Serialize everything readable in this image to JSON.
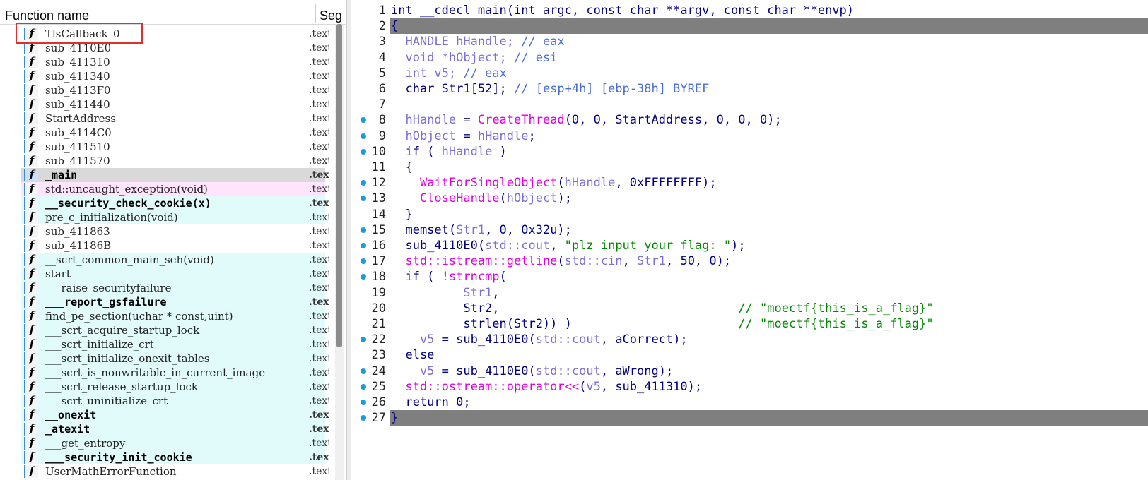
{
  "functions_pane": {
    "header": {
      "name_label": "Function name",
      "segment_label": "Seg"
    },
    "rows": [
      {
        "name": "TlsCallback_0",
        "segment": ".text",
        "style": "normal",
        "bold": false
      },
      {
        "name": "sub_4110E0",
        "segment": ".text",
        "style": "normal",
        "bold": false
      },
      {
        "name": "sub_411310",
        "segment": ".text",
        "style": "normal",
        "bold": false
      },
      {
        "name": "sub_411340",
        "segment": ".text",
        "style": "normal",
        "bold": false
      },
      {
        "name": "sub_4113F0",
        "segment": ".text",
        "style": "normal",
        "bold": false
      },
      {
        "name": "sub_411440",
        "segment": ".text",
        "style": "normal",
        "bold": false
      },
      {
        "name": "StartAddress",
        "segment": ".text",
        "style": "normal",
        "bold": false
      },
      {
        "name": "sub_4114C0",
        "segment": ".text",
        "style": "normal",
        "bold": false
      },
      {
        "name": "sub_411510",
        "segment": ".text",
        "style": "normal",
        "bold": false
      },
      {
        "name": "sub_411570",
        "segment": ".text",
        "style": "normal",
        "bold": false
      },
      {
        "name": "_main",
        "segment": ".text",
        "style": "selected",
        "bold": true
      },
      {
        "name": "std::uncaught_exception(void)",
        "segment": ".text",
        "style": "pink",
        "bold": false
      },
      {
        "name": "__security_check_cookie(x)",
        "segment": ".text",
        "style": "lib",
        "bold": true
      },
      {
        "name": "pre_c_initialization(void)",
        "segment": ".text",
        "style": "lib",
        "bold": false
      },
      {
        "name": "sub_411863",
        "segment": ".text",
        "style": "normal",
        "bold": false
      },
      {
        "name": "sub_41186B",
        "segment": ".text",
        "style": "normal",
        "bold": false
      },
      {
        "name": "__scrt_common_main_seh(void)",
        "segment": ".text",
        "style": "lib",
        "bold": false
      },
      {
        "name": "start",
        "segment": ".text",
        "style": "lib",
        "bold": false
      },
      {
        "name": "___raise_securityfailure",
        "segment": ".text",
        "style": "lib",
        "bold": false
      },
      {
        "name": "___report_gsfailure",
        "segment": ".text",
        "style": "lib",
        "bold": true
      },
      {
        "name": "find_pe_section(uchar * const,uint)",
        "segment": ".text",
        "style": "lib",
        "bold": false
      },
      {
        "name": "___scrt_acquire_startup_lock",
        "segment": ".text",
        "style": "lib",
        "bold": false
      },
      {
        "name": "___scrt_initialize_crt",
        "segment": ".text",
        "style": "lib",
        "bold": false
      },
      {
        "name": "___scrt_initialize_onexit_tables",
        "segment": ".text",
        "style": "lib",
        "bold": false
      },
      {
        "name": "___scrt_is_nonwritable_in_current_image",
        "segment": ".text",
        "style": "lib",
        "bold": false
      },
      {
        "name": "___scrt_release_startup_lock",
        "segment": ".text",
        "style": "lib",
        "bold": false
      },
      {
        "name": "___scrt_uninitialize_crt",
        "segment": ".text",
        "style": "lib",
        "bold": false
      },
      {
        "name": "__onexit",
        "segment": ".text",
        "style": "lib",
        "bold": true
      },
      {
        "name": "_atexit",
        "segment": ".text",
        "style": "lib",
        "bold": true
      },
      {
        "name": "___get_entropy",
        "segment": ".text",
        "style": "lib",
        "bold": false
      },
      {
        "name": "___security_init_cookie",
        "segment": ".text",
        "style": "lib",
        "bold": true
      },
      {
        "name": "UserMathErrorFunction",
        "segment": ".text",
        "style": "normal",
        "bold": false
      }
    ],
    "icon_glyph": "f"
  },
  "pseudocode_pane": {
    "lines": [
      {
        "n": "1",
        "dot": false,
        "hl": false,
        "parts": [
          [
            "kw",
            "int __cdecl main(int argc, const char **argv, const char **envp)"
          ]
        ]
      },
      {
        "n": "2",
        "dot": false,
        "hl": true,
        "parts": [
          [
            "kw",
            "{"
          ]
        ]
      },
      {
        "n": "3",
        "dot": false,
        "hl": false,
        "parts": [
          [
            "var",
            "  HANDLE hHandle; "
          ],
          [
            "cm",
            "// eax"
          ]
        ]
      },
      {
        "n": "4",
        "dot": false,
        "hl": false,
        "parts": [
          [
            "var",
            "  void *hObject; "
          ],
          [
            "cm",
            "// esi"
          ]
        ]
      },
      {
        "n": "5",
        "dot": false,
        "hl": false,
        "parts": [
          [
            "var",
            "  int v5; "
          ],
          [
            "cm",
            "// eax"
          ]
        ]
      },
      {
        "n": "6",
        "dot": false,
        "hl": false,
        "parts": [
          [
            "kw",
            "  char Str1[52]; "
          ],
          [
            "cm",
            "// [esp+4h] [ebp-38h] BYREF"
          ]
        ]
      },
      {
        "n": "7",
        "dot": false,
        "hl": false,
        "parts": [
          [
            "kw",
            ""
          ]
        ]
      },
      {
        "n": "8",
        "dot": true,
        "hl": false,
        "parts": [
          [
            "var",
            "  hHandle"
          ],
          [
            "kw",
            " = "
          ],
          [
            "fn",
            "CreateThread"
          ],
          [
            "kw",
            "(0, 0, StartAddress, 0, 0, 0);"
          ]
        ]
      },
      {
        "n": "9",
        "dot": true,
        "hl": false,
        "parts": [
          [
            "var",
            "  hObject"
          ],
          [
            "kw",
            " = "
          ],
          [
            "var",
            "hHandle"
          ],
          [
            "kw",
            ";"
          ]
        ]
      },
      {
        "n": "10",
        "dot": true,
        "hl": false,
        "parts": [
          [
            "kw",
            "  if ( "
          ],
          [
            "var",
            "hHandle"
          ],
          [
            "kw",
            " )"
          ]
        ]
      },
      {
        "n": "11",
        "dot": false,
        "hl": false,
        "parts": [
          [
            "kw",
            "  {"
          ]
        ]
      },
      {
        "n": "12",
        "dot": true,
        "hl": false,
        "parts": [
          [
            "kw",
            "    "
          ],
          [
            "fn",
            "WaitForSingleObject"
          ],
          [
            "kw",
            "("
          ],
          [
            "var",
            "hHandle"
          ],
          [
            "kw",
            ", 0xFFFFFFFF);"
          ]
        ]
      },
      {
        "n": "13",
        "dot": true,
        "hl": false,
        "parts": [
          [
            "kw",
            "    "
          ],
          [
            "fn",
            "CloseHandle"
          ],
          [
            "kw",
            "("
          ],
          [
            "var",
            "hObject"
          ],
          [
            "kw",
            ");"
          ]
        ]
      },
      {
        "n": "14",
        "dot": false,
        "hl": false,
        "parts": [
          [
            "kw",
            "  }"
          ]
        ]
      },
      {
        "n": "15",
        "dot": true,
        "hl": false,
        "parts": [
          [
            "kw",
            "  memset("
          ],
          [
            "var",
            "Str1"
          ],
          [
            "kw",
            ", 0, 0x32u);"
          ]
        ]
      },
      {
        "n": "16",
        "dot": true,
        "hl": false,
        "parts": [
          [
            "kw",
            "  sub_4110E0("
          ],
          [
            "var",
            "std::cout"
          ],
          [
            "kw",
            ", "
          ],
          [
            "str",
            "\"plz input your flag: \""
          ],
          [
            "kw",
            ");"
          ]
        ]
      },
      {
        "n": "17",
        "dot": true,
        "hl": false,
        "parts": [
          [
            "fn",
            "  std::istream::getline"
          ],
          [
            "kw",
            "("
          ],
          [
            "var",
            "std::cin"
          ],
          [
            "kw",
            ", "
          ],
          [
            "var",
            "Str1"
          ],
          [
            "kw",
            ", 50, 0);"
          ]
        ]
      },
      {
        "n": "18",
        "dot": true,
        "hl": false,
        "parts": [
          [
            "kw",
            "  if ( !"
          ],
          [
            "fn",
            "strncmp"
          ],
          [
            "kw",
            "("
          ]
        ]
      },
      {
        "n": "19",
        "dot": false,
        "hl": false,
        "parts": [
          [
            "var",
            "          Str1"
          ],
          [
            "kw",
            ","
          ]
        ]
      },
      {
        "n": "20",
        "dot": false,
        "hl": false,
        "parts": [
          [
            "kw",
            "          Str2,                                 "
          ],
          [
            "str",
            "// \"moectf{this_is_a_flag}\""
          ]
        ]
      },
      {
        "n": "21",
        "dot": false,
        "hl": false,
        "parts": [
          [
            "kw",
            "          strlen(Str2)) )                       "
          ],
          [
            "str",
            "// \"moectf{this_is_a_flag}\""
          ]
        ]
      },
      {
        "n": "22",
        "dot": true,
        "hl": false,
        "parts": [
          [
            "var",
            "    v5"
          ],
          [
            "kw",
            " = sub_4110E0("
          ],
          [
            "var",
            "std::cout"
          ],
          [
            "kw",
            ", aCorrect);"
          ]
        ]
      },
      {
        "n": "23",
        "dot": false,
        "hl": false,
        "parts": [
          [
            "kw",
            "  else"
          ]
        ]
      },
      {
        "n": "24",
        "dot": true,
        "hl": false,
        "parts": [
          [
            "var",
            "    v5"
          ],
          [
            "kw",
            " = sub_4110E0("
          ],
          [
            "var",
            "std::cout"
          ],
          [
            "kw",
            ", aWrong);"
          ]
        ]
      },
      {
        "n": "25",
        "dot": true,
        "hl": false,
        "parts": [
          [
            "fn",
            "  std::ostream::operator<<"
          ],
          [
            "kw",
            "("
          ],
          [
            "var",
            "v5"
          ],
          [
            "kw",
            ", sub_411310);"
          ]
        ]
      },
      {
        "n": "26",
        "dot": true,
        "hl": false,
        "parts": [
          [
            "kw",
            "  return 0;"
          ]
        ]
      },
      {
        "n": "27",
        "dot": true,
        "hl": true,
        "parts": [
          [
            "kw",
            "}"
          ]
        ]
      }
    ]
  }
}
